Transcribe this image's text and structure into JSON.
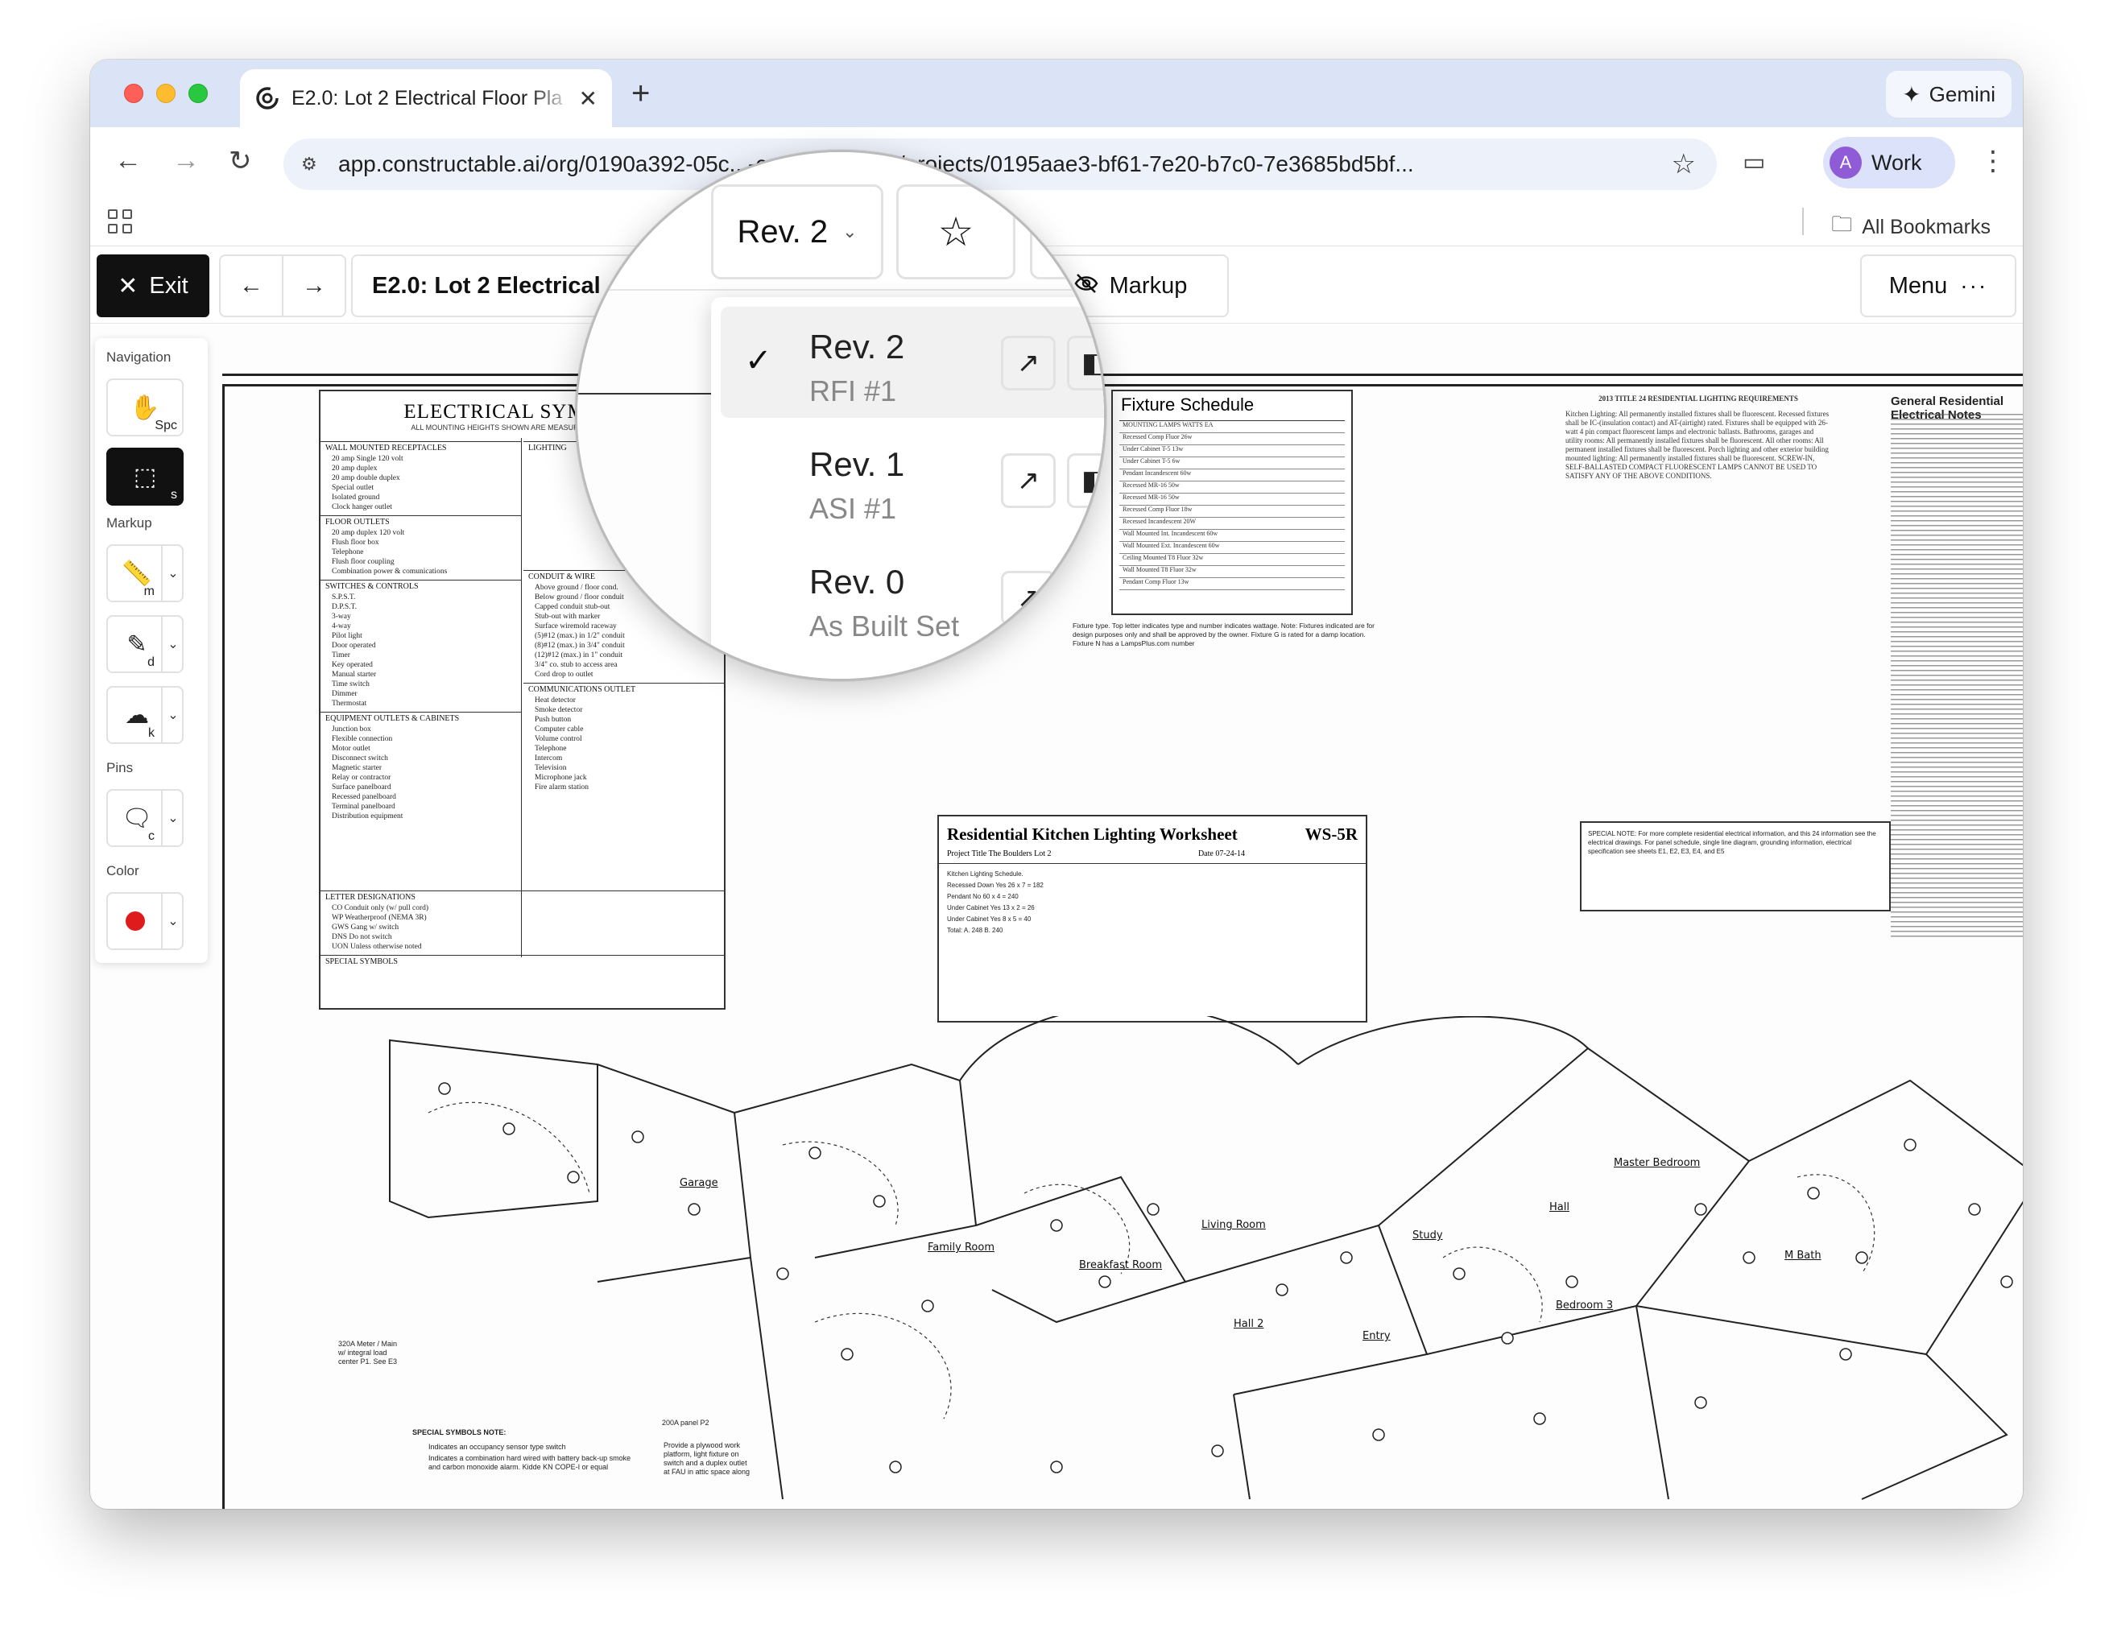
{
  "browser": {
    "tab_title": "E2.0: Lot 2 Electrical Floor Pla",
    "new_tab_label": "+",
    "gemini_label": "Gemini",
    "url": "app.constructable.ai/org/0190a392-05c...-ceafa7b624bb/projects/0195aae3-bf61-7e20-b7c0-7e3685bd5bf...",
    "profile_initial": "A",
    "profile_label": "Work",
    "all_bookmarks_label": "All Bookmarks"
  },
  "appbar": {
    "exit_label": "Exit",
    "doc_title": "E2.0: Lot 2 Electrical",
    "markup_label": "Markup",
    "menu_label": "Menu"
  },
  "tools": {
    "navigation_label": "Navigation",
    "markup_label": "Markup",
    "pins_label": "Pins",
    "color_label": "Color",
    "pan_key": "Spc",
    "select_key": "s",
    "measure_key": "m",
    "draw_key": "d",
    "cloud_key": "k",
    "comment_key": "c",
    "selected_color": "#e01b1b"
  },
  "revisions": {
    "current": "Rev. 2",
    "items": [
      {
        "name": "Rev. 2",
        "sub": "RFI #1",
        "selected": true
      },
      {
        "name": "Rev. 1",
        "sub": "ASI #1",
        "selected": false
      },
      {
        "name": "Rev. 0",
        "sub": "As Built Set",
        "selected": false
      }
    ]
  },
  "drawing": {
    "legend_title": "ELECTRICAL SYMBOLS",
    "legend_subhead": "ALL MOUNTING HEIGHTS SHOWN ARE MEASURED TO BOTTOM",
    "legend_sections": {
      "wall": "WALL MOUNTED RECEPTACLES",
      "floor": "FLOOR OUTLETS",
      "switches": "SWITCHES & CONTROLS",
      "equipment": "EQUIPMENT OUTLETS & CABINETS",
      "letters": "LETTER DESIGNATIONS",
      "special": "SPECIAL SYMBOLS",
      "lighting": "LIGHTING",
      "conduit": "CONDUIT & WIRE",
      "comms": "COMMUNICATIONS OUTLET"
    },
    "wall_rows": [
      "20 amp Single 120 volt",
      "20 amp duplex",
      "20 amp double duplex",
      "Special outlet",
      "Isolated ground",
      "Clock hanger outlet"
    ],
    "floor_rows": [
      "20 amp duplex 120 volt",
      "Flush floor box",
      "Telephone",
      "Flush floor coupling",
      "Combination power & comunications"
    ],
    "switch_rows": [
      "S.P.S.T.",
      "D.P.S.T.",
      "3-way",
      "4-way",
      "Pilot light",
      "Door operated",
      "Timer",
      "Key operated",
      "Manual starter",
      "Time switch",
      "Dimmer",
      "Thermostat"
    ],
    "equip_rows": [
      "Junction box",
      "Flexible connection",
      "Motor outlet",
      "Disconnect switch",
      "Magnetic starter",
      "Relay or contractor",
      "Surface panelboard",
      "Recessed panelboard",
      "Terminal panelboard",
      "Distribution equipment"
    ],
    "letter_rows": [
      "CO Conduit only (w/ pull cord)",
      "WP Weatherproof (NEMA 3R)",
      "GWS Gang w/ switch",
      "DNS Do not switch",
      "UON Unless otherwise noted"
    ],
    "conduit_rows": [
      "Above ground / floor cond.",
      "Below ground / floor conduit",
      "Capped conduit stub-out",
      "Stub-out with marker",
      "Surface wiremold raceway",
      "(5)#12 (max.) in 1/2\" conduit",
      "(8)#12 (max.) in 3/4\" conduit",
      "(12)#12 (max.) in 1\" conduit",
      "3/4\" co. stub to access area",
      "Cord drop to outlet"
    ],
    "comm_rows": [
      "Heat detector",
      "Smoke detector",
      "Push button",
      "Computer cable",
      "Volume control",
      "Telephone",
      "Intercom",
      "Television",
      "Microphone jack",
      "Fire alarm station"
    ],
    "fixture_title": "Fixture Schedule",
    "fixture_rows": [
      "MOUNTING  LAMPS  WATTS EA",
      "Recessed  Comp Fluor  26w",
      "Under Cabinet  T-5  13w",
      "Under Cabinet  T-5  6w",
      "Pendant  Incandescent  60w",
      "Recessed  MR-16  50w",
      "Recessed  MR-16  50w",
      "Recessed  Comp Fluor  18w",
      "Recessed  Incandescent  20W",
      "Wall Mounted Int.  Incandescent  60w",
      "Wall Mounted Ext.  Incandescent  60w",
      "Ceiling Mounted  T8 Fluor  32w",
      "Wall Mounted  T8 Fluor  32w",
      "Pendant  Comp Fluor  13w"
    ],
    "kitchen_title": "Residential Kitchen Lighting Worksheet",
    "kitchen_code": "WS-5R",
    "kitchen_project": "Project Title  The Boulders Lot 2",
    "kitchen_date": "Date  07-24-14",
    "kitchen_rows": [
      "Kitchen Lighting Schedule.",
      "Recessed Down  Yes  26 x 7 = 182",
      "Pendant  No  60 x 4 = 240",
      "Under Cabinet  Yes  13 x 2 = 26",
      "Under Cabinet  Yes  8 x 5 = 40",
      "Total:  A. 248  B. 240"
    ],
    "reqs_title": "2013 TITLE 24 RESIDENTIAL LIGHTING REQUIREMENTS",
    "reqs_text": "Kitchen Lighting: All permanently installed fixtures shall be fluorescent. Recessed fixtures shall be IC-(insulation contact) and AT-(airtight) rated. Fixtures shall be equipped with 26-watt 4 pin compact fluorescent lamps and electronic ballasts. Bathrooms, garages and utility rooms: All permanently installed fixtures shall be fluorescent. All other rooms: All permanent installed fixtures shall be fluorescent. Porch lighting and other exterior building mounted lighting: All permanently installed fixtures shall be fluorescent. SCREW-IN, SELF-BALLASTED COMPACT FLUORESCENT LAMPS CANNOT BE USED TO SATISFY ANY OF THE ABOVE CONDITIONS.",
    "gen_notes_title": "General Residential Electrical Notes",
    "special_note": "SPECIAL NOTE: For more complete residential electrical information, and this 24 information see the electrical drawings. For panel schedule, single line diagram, grounding information, electrical specification see sheets E1, E2, E3, E4, and E5",
    "mid_notes": "Fixture type. Top letter indicates type and number indicates wattage. Note: Fixtures indicated are for design purposes only and shall be approved by the owner. Fixture G is rated for a damp location. Fixture N has a LampsPlus.com number",
    "rooms": [
      "Garage",
      "Family Room",
      "Breakfast Room",
      "Living Room",
      "Study",
      "Master Bedroom",
      "M Bath",
      "Bedroom 3",
      "Hall 2",
      "Entry",
      "Hall"
    ],
    "panel_note": "320A Meter / Main w/ integral load center P1. See E3",
    "sym_note_title": "SPECIAL SYMBOLS NOTE:",
    "sym_note_1": "Indicates an occupancy sensor type switch",
    "sym_note_2": "Indicates a combination hard wired with battery back-up smoke and carbon monoxide alarm. Kidde KN COPE-I or equal",
    "panel2_note": "200A panel P2",
    "access_note": "Provide a plywood work platform, light fixture on switch and a duplex outlet at FAU in attic space along"
  }
}
